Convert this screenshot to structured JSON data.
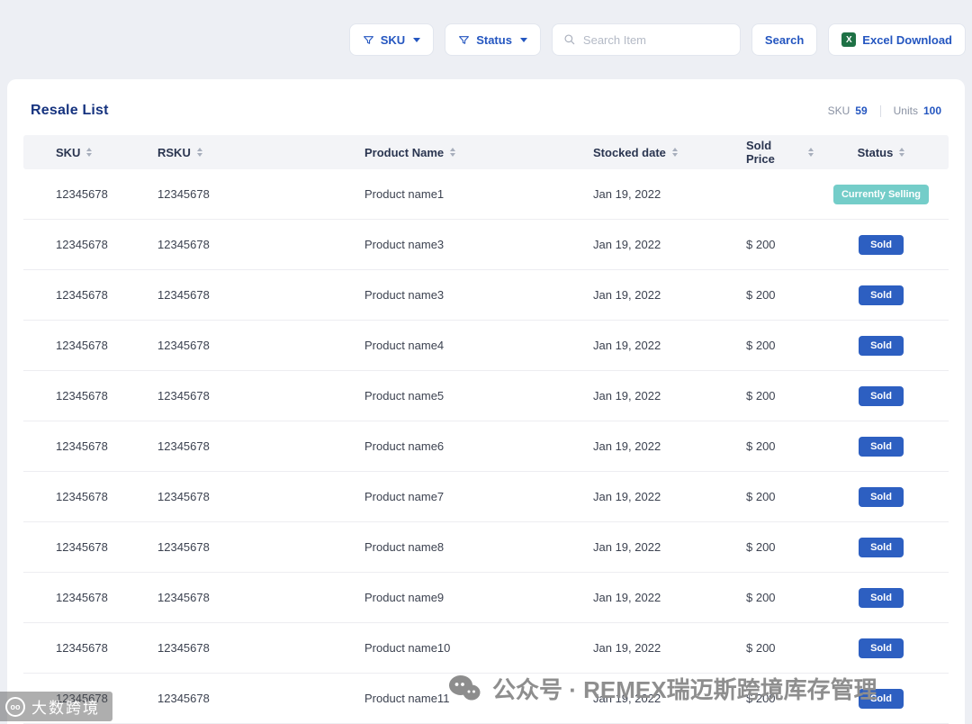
{
  "topbar": {
    "sku_filter_label": "SKU",
    "status_filter_label": "Status",
    "search_placeholder": "Search Item",
    "search_button_label": "Search",
    "excel_button_label": "Excel Download"
  },
  "page": {
    "title": "Resale List",
    "summary": {
      "sku_label": "SKU",
      "sku_value": "59",
      "units_label": "Units",
      "units_value": "100"
    }
  },
  "table": {
    "columns": [
      "SKU",
      "RSKU",
      "Product Name",
      "Stocked date",
      "Sold Price",
      "Status"
    ],
    "rows": [
      {
        "sku": "12345678",
        "rsku": "12345678",
        "product": "Product name1",
        "date": "Jan 19, 2022",
        "price": "",
        "status": "Currently Selling",
        "status_type": "selling"
      },
      {
        "sku": "12345678",
        "rsku": "12345678",
        "product": "Product name3",
        "date": "Jan 19, 2022",
        "price": "$ 200",
        "status": "Sold",
        "status_type": "sold"
      },
      {
        "sku": "12345678",
        "rsku": "12345678",
        "product": "Product name3",
        "date": "Jan 19, 2022",
        "price": "$ 200",
        "status": "Sold",
        "status_type": "sold"
      },
      {
        "sku": "12345678",
        "rsku": "12345678",
        "product": "Product name4",
        "date": "Jan 19, 2022",
        "price": "$ 200",
        "status": "Sold",
        "status_type": "sold"
      },
      {
        "sku": "12345678",
        "rsku": "12345678",
        "product": "Product name5",
        "date": "Jan 19, 2022",
        "price": "$ 200",
        "status": "Sold",
        "status_type": "sold"
      },
      {
        "sku": "12345678",
        "rsku": "12345678",
        "product": "Product name6",
        "date": "Jan 19, 2022",
        "price": "$ 200",
        "status": "Sold",
        "status_type": "sold"
      },
      {
        "sku": "12345678",
        "rsku": "12345678",
        "product": "Product name7",
        "date": "Jan 19, 2022",
        "price": "$ 200",
        "status": "Sold",
        "status_type": "sold"
      },
      {
        "sku": "12345678",
        "rsku": "12345678",
        "product": "Product name8",
        "date": "Jan 19, 2022",
        "price": "$ 200",
        "status": "Sold",
        "status_type": "sold"
      },
      {
        "sku": "12345678",
        "rsku": "12345678",
        "product": "Product name9",
        "date": "Jan 19, 2022",
        "price": "$ 200",
        "status": "Sold",
        "status_type": "sold"
      },
      {
        "sku": "12345678",
        "rsku": "12345678",
        "product": "Product name10",
        "date": "Jan 19, 2022",
        "price": "$ 200",
        "status": "Sold",
        "status_type": "sold"
      },
      {
        "sku": "12345678",
        "rsku": "12345678",
        "product": "Product name11",
        "date": "Jan 19, 2022",
        "price": "$ 200",
        "status": "Sold",
        "status_type": "sold"
      }
    ]
  },
  "watermark": {
    "center": "公众号 · REMEX瑞迈斯跨境库存管理",
    "corner": "大数跨境"
  },
  "colors": {
    "accent": "#2456c0",
    "title": "#16337f",
    "sold": "#2d5fc1",
    "selling": "#74cdc9"
  }
}
